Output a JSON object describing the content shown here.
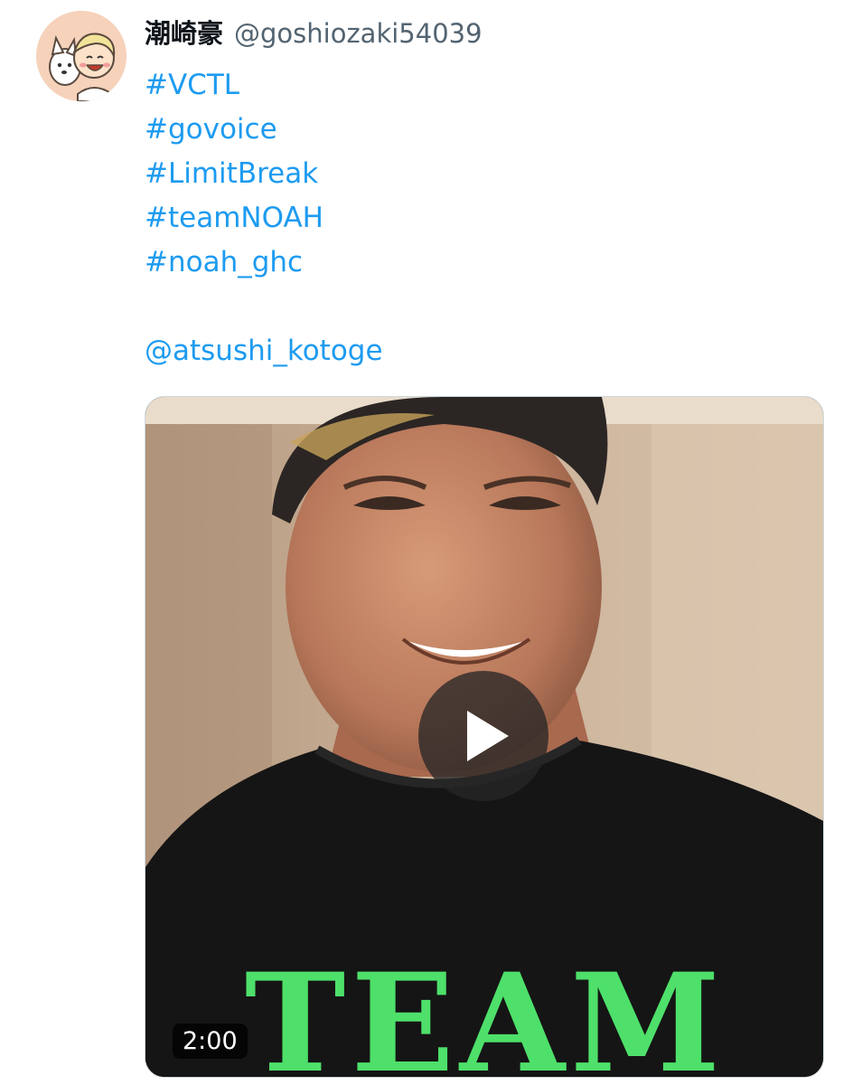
{
  "tweet": {
    "author": {
      "display_name": "潮崎豪",
      "handle": "@goshiozaki54039"
    },
    "lines": [
      "#VCTL",
      "#govoice",
      "#LimitBreak",
      "#teamNOAH",
      "#noah_ghc",
      "",
      "@atsushi_kotoge"
    ],
    "media": {
      "type": "video",
      "duration": "2:00",
      "play_icon": "play-icon",
      "shirt_text": "TEAM"
    }
  },
  "colors": {
    "link": "#1d9bf0",
    "name": "#0f1419",
    "handle": "#536471"
  }
}
